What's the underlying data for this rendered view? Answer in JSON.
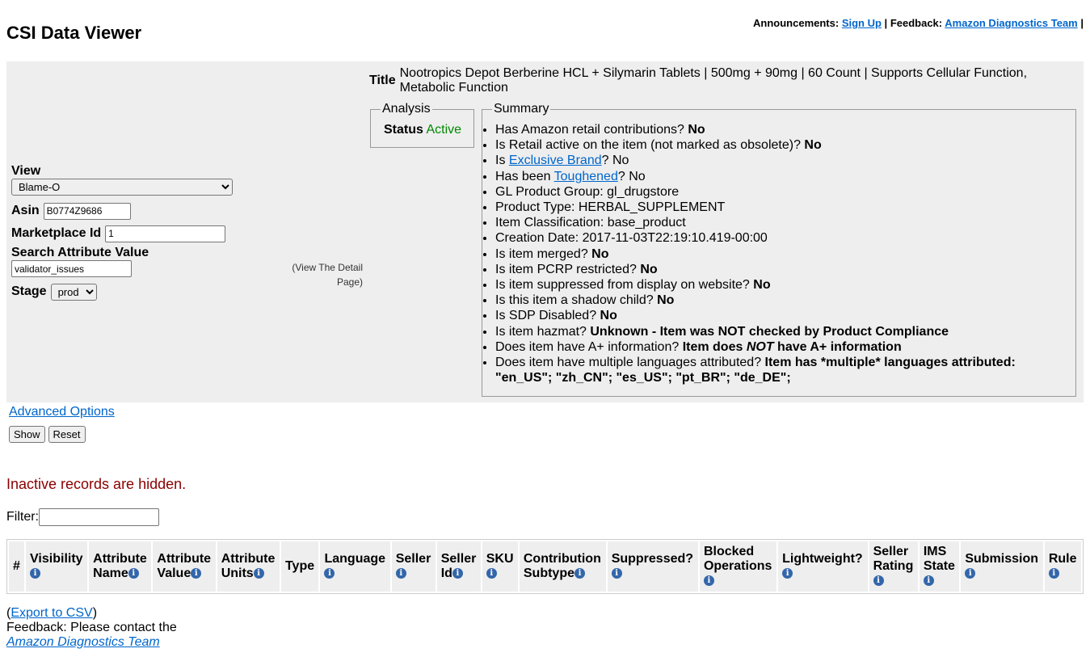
{
  "header": {
    "announcements_label": "Announcements:",
    "signup_link": "Sign Up",
    "separator": "|",
    "feedback_label": "Feedback:",
    "team_link": "Amazon Diagnostics Team",
    "trailing_sep": "|"
  },
  "page_title": "CSI Data Viewer",
  "form": {
    "view_label": "View",
    "view_value": "Blame-O",
    "asin_label": "Asin",
    "asin_value": "B0774Z9686",
    "marketplace_label": "Marketplace Id",
    "marketplace_value": "1",
    "search_label": "Search Attribute Value",
    "search_value": "validator_issues",
    "stage_label": "Stage",
    "stage_value": "prod"
  },
  "detail_link": "(View The Detail Page)",
  "item": {
    "title_label": "Title",
    "title_value": "Nootropics Depot Berberine HCL + Silymarin Tablets | 500mg + 90mg | 60 Count | Supports Cellular Function, Metabolic Function"
  },
  "analysis": {
    "legend": "Analysis",
    "status_label": "Status",
    "status_value": "Active",
    "status_color": "#008800"
  },
  "summary": {
    "legend": "Summary",
    "items": [
      {
        "text": "Has Amazon retail contributions? ",
        "bold": "No"
      },
      {
        "text": "Is Retail active on the item (not marked as obsolete)? ",
        "bold": "No"
      },
      {
        "pre": "Is ",
        "link": "Exclusive Brand",
        "post": "? No"
      },
      {
        "pre": "Has been ",
        "link": "Toughened",
        "post": "? No"
      },
      {
        "text": "GL Product Group: gl_drugstore"
      },
      {
        "text": "Product Type: HERBAL_SUPPLEMENT"
      },
      {
        "text": "Item Classification: base_product"
      },
      {
        "text": "Creation Date: 2017-11-03T22:19:10.419-00:00"
      },
      {
        "text": "Is item merged? ",
        "bold": "No"
      },
      {
        "text": "Is item PCRP restricted? ",
        "bold": "No"
      },
      {
        "text": "Is item suppressed from display on website? ",
        "bold": "No"
      },
      {
        "text": "Is this item a shadow child? ",
        "bold": "No"
      },
      {
        "text": "Is SDP Disabled? ",
        "bold": "No"
      },
      {
        "text": "Is item hazmat? ",
        "bold": "Unknown - Item was NOT checked by Product Compliance"
      },
      {
        "text": "Does item have A+ information? ",
        "bold": "Item does ",
        "italic": "NOT",
        "bold2": " have A+ information"
      },
      {
        "text": "Does item have multiple languages attributed? ",
        "bold": "Item has *multiple* languages attributed: \"en_US\"; \"zh_CN\"; \"es_US\"; \"pt_BR\"; \"de_DE\";"
      }
    ]
  },
  "advanced_options": "Advanced Options",
  "buttons": {
    "show": "Show",
    "reset": "Reset"
  },
  "inactive_notice": "Inactive records are hidden.",
  "inactive_color": "#8b0000",
  "filter_label": "Filter:",
  "table": {
    "columns": [
      {
        "l1": "#",
        "icon": false
      },
      {
        "l1": "Visibility",
        "icon": "below"
      },
      {
        "l1": "Attribute",
        "l2": "Name",
        "icon": "inline"
      },
      {
        "l1": "Attribute",
        "l2": "Value",
        "icon": "inline"
      },
      {
        "l1": "Attribute",
        "l2": "Units",
        "icon": "inline"
      },
      {
        "l1": "Type",
        "icon": false
      },
      {
        "l1": "Language",
        "icon": "below"
      },
      {
        "l1": "Seller",
        "icon": "below"
      },
      {
        "l1": "Seller",
        "l2": "Id",
        "icon": "inline"
      },
      {
        "l1": "SKU",
        "icon": "below"
      },
      {
        "l1": "Contribution",
        "l2": "Subtype",
        "icon": "inline"
      },
      {
        "l1": "Suppressed?",
        "icon": "below"
      },
      {
        "l1": "Blocked",
        "l2": "Operations",
        "icon": "below"
      },
      {
        "l1": "Lightweight?",
        "icon": "below"
      },
      {
        "l1": "Seller",
        "l2": "Rating",
        "icon": "below"
      },
      {
        "l1": "IMS",
        "l2": "State",
        "icon": "below"
      },
      {
        "l1": "Submission",
        "icon": "below"
      },
      {
        "l1": "Rule",
        "icon": "below"
      }
    ]
  },
  "footer": {
    "export_open": "(",
    "export_link": "Export to CSV",
    "export_close": ")",
    "feedback_text": "Feedback: Please contact the",
    "team_link": "Amazon Diagnostics Team"
  },
  "icons": {
    "info": "info-icon"
  }
}
